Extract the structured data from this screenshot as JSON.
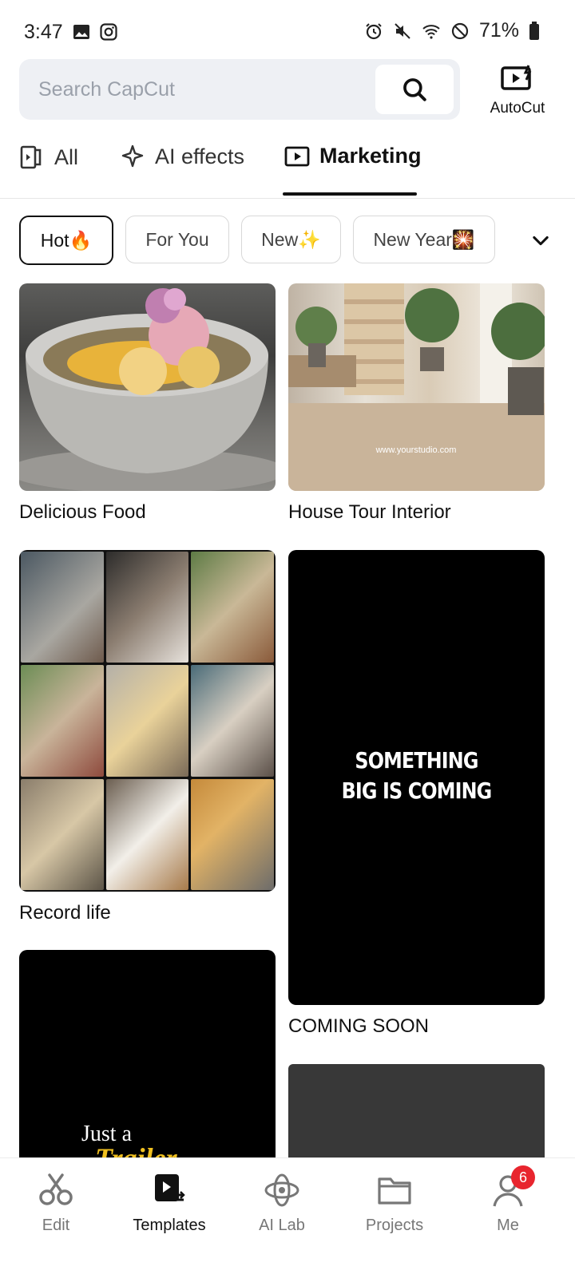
{
  "status_bar": {
    "time": "3:47",
    "battery": "71%"
  },
  "search": {
    "placeholder": "Search CapCut"
  },
  "autocut": {
    "label": "AutoCut"
  },
  "tabs": [
    {
      "label": "All",
      "icon": "clip-icon"
    },
    {
      "label": "AI effects",
      "icon": "sparkle-icon"
    },
    {
      "label": "Marketing",
      "icon": "play-square-icon",
      "active": true
    }
  ],
  "chips": [
    {
      "label": "Hot🔥",
      "active": true
    },
    {
      "label": "For You"
    },
    {
      "label": "New✨"
    },
    {
      "label": "New Year🎇"
    }
  ],
  "templates": {
    "t1": {
      "title": "Delicious Food"
    },
    "t2": {
      "title": "House Tour Interior",
      "watermark": "www.yourstudio.com"
    },
    "t3": {
      "title": "Record life"
    },
    "t4": {
      "title": "COMING SOON",
      "overlay_line1": "SOMETHING",
      "overlay_line2": "BIG IS COMING"
    },
    "t5": {
      "overlay_line1": "Just a",
      "overlay_line2": "Trailer"
    }
  },
  "bottom_nav": {
    "edit": "Edit",
    "templates": "Templates",
    "ai_lab": "AI Lab",
    "projects": "Projects",
    "me": "Me",
    "me_badge": "6"
  },
  "colors": {
    "badge": "#e8252e",
    "search_bg": "#eef0f4"
  }
}
